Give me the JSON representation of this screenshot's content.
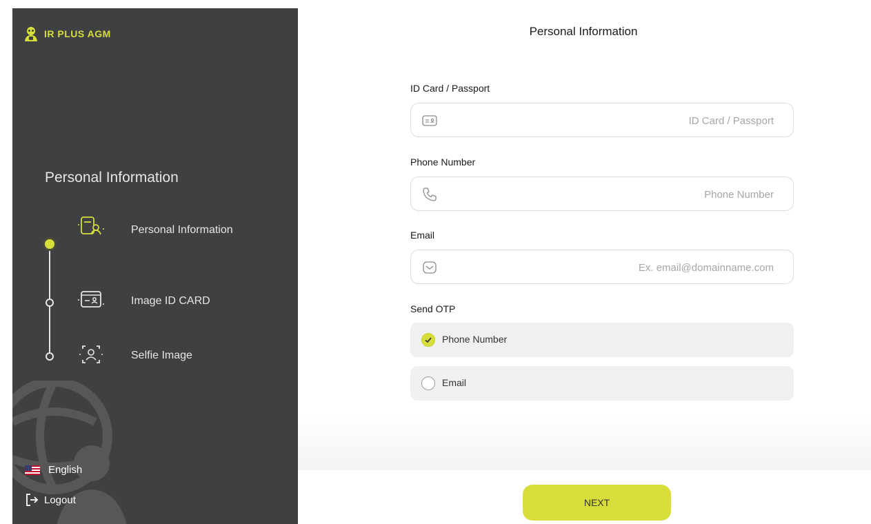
{
  "brand": {
    "name": "IR PLUS AGM",
    "accent_color": "#d7dd3a"
  },
  "sidebar": {
    "title": "Personal Information",
    "steps": [
      {
        "label": "Personal Information",
        "icon": "id-card-person-icon",
        "active": true
      },
      {
        "label": "Image ID CARD",
        "icon": "id-card-icon",
        "active": false
      },
      {
        "label": "Selfie Image",
        "icon": "selfie-frame-icon",
        "active": false
      }
    ],
    "language": {
      "label": "English",
      "icon": "us-flag-icon"
    },
    "logout": {
      "label": "Logout",
      "icon": "logout-icon"
    }
  },
  "main": {
    "title": "Personal Information",
    "fields": {
      "id_card": {
        "label": "ID Card / Passport",
        "placeholder": "ID Card / Passport",
        "value": "",
        "icon": "id-card-icon"
      },
      "phone": {
        "label": "Phone Number",
        "placeholder": "Phone Number",
        "value": "",
        "icon": "phone-icon"
      },
      "email": {
        "label": "Email",
        "placeholder": "Ex. email@domainname.com",
        "value": "",
        "icon": "mail-icon"
      }
    },
    "otp": {
      "label": "Send OTP",
      "options": [
        {
          "label": "Phone Number",
          "selected": true
        },
        {
          "label": "Email",
          "selected": false
        }
      ]
    },
    "next_label": "NEXT"
  }
}
